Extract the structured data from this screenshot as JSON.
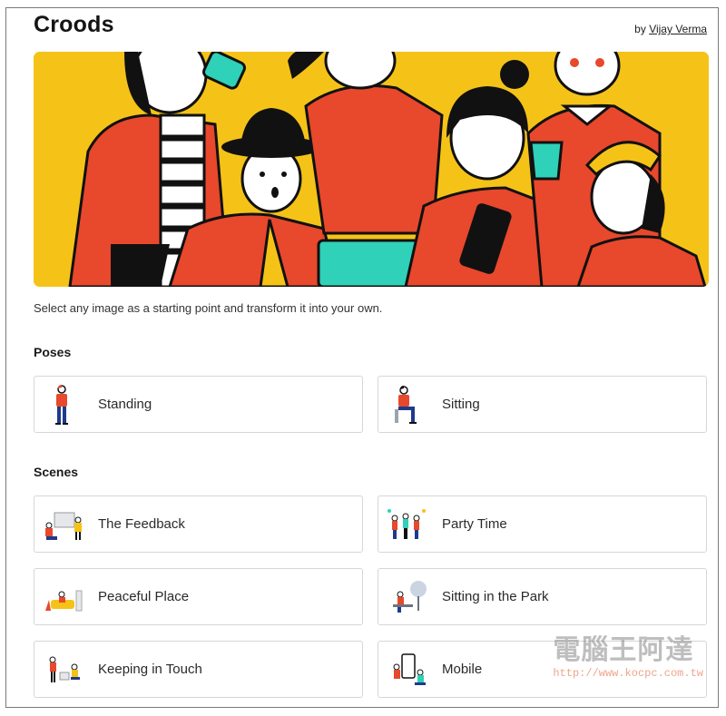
{
  "header": {
    "title": "Croods",
    "by_prefix": "by",
    "author": "Vijay Verma"
  },
  "description": "Select any image as a starting point and transform it into your own.",
  "sections": {
    "poses": {
      "title": "Poses",
      "items": [
        {
          "label": "Standing",
          "icon": "standing-figure-icon"
        },
        {
          "label": "Sitting",
          "icon": "sitting-figure-icon"
        }
      ]
    },
    "scenes": {
      "title": "Scenes",
      "items": [
        {
          "label": "The Feedback",
          "icon": "feedback-scene-icon"
        },
        {
          "label": "Party Time",
          "icon": "party-scene-icon"
        },
        {
          "label": "Peaceful Place",
          "icon": "peaceful-scene-icon"
        },
        {
          "label": "Sitting in the Park",
          "icon": "park-scene-icon"
        },
        {
          "label": "Keeping in Touch",
          "icon": "touch-scene-icon"
        },
        {
          "label": "Mobile",
          "icon": "mobile-scene-icon"
        }
      ]
    }
  },
  "watermark": {
    "text": "電腦王阿達",
    "url": "http://www.kocpc.com.tw"
  },
  "colors": {
    "hero_bg": "#F5C318",
    "accent_red": "#E8482C",
    "accent_teal": "#2FD1B8",
    "ink": "#111111"
  }
}
